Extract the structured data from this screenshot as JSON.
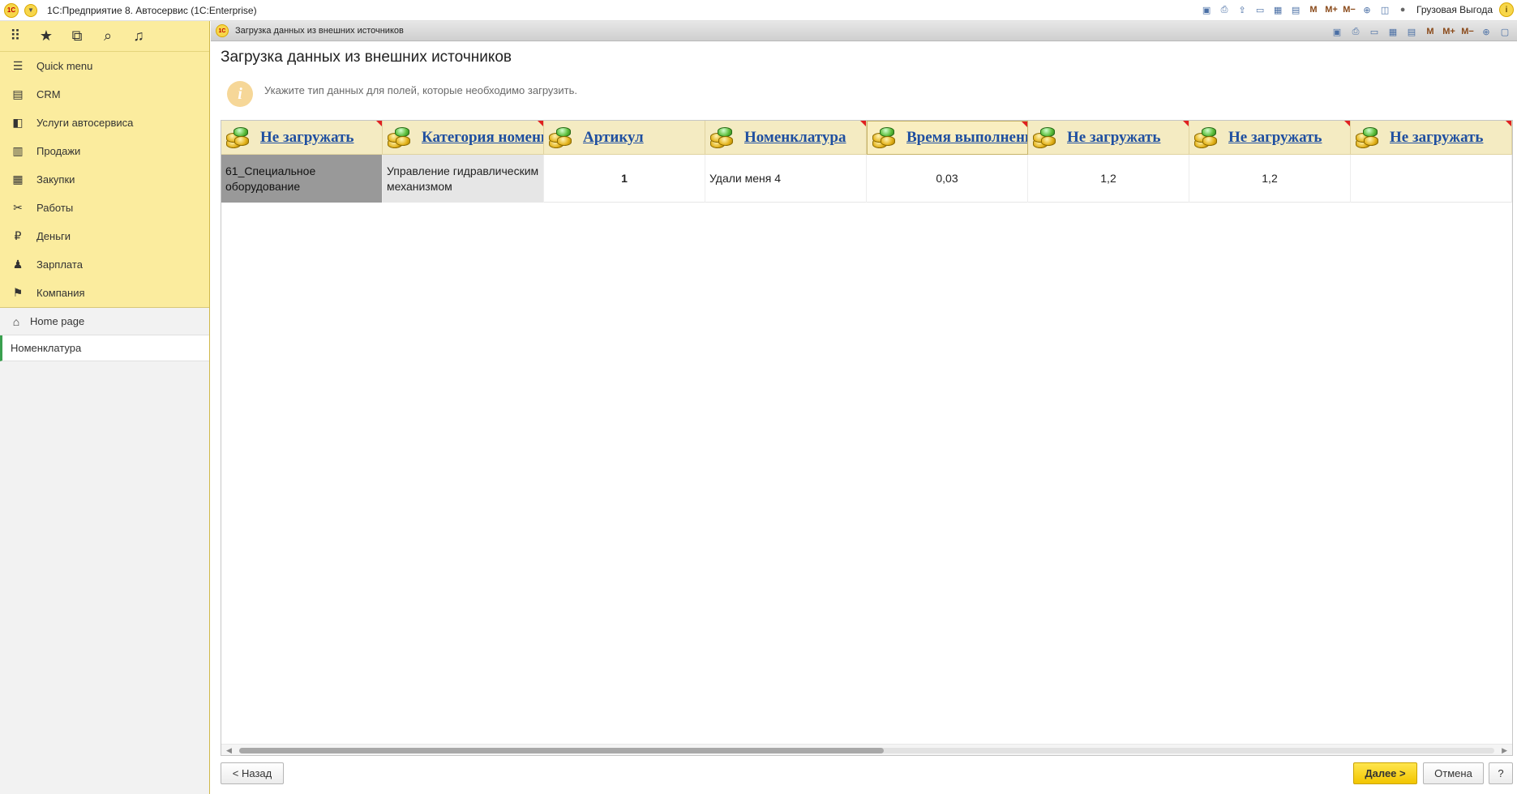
{
  "titlebar": {
    "logo": "1С",
    "app_title": "1С:Предприятие 8. Автосервис  (1С:Enterprise)",
    "user": "Грузовая Выгода",
    "icons": [
      "save-icon",
      "print-icon",
      "upload-icon",
      "print-preview-icon",
      "calculator-icon",
      "calendar-icon",
      "M",
      "M+",
      "M-",
      "zoom-icon",
      "panels-icon",
      "user-icon",
      "info-icon"
    ],
    "m_labels": [
      "M",
      "M+",
      "M−"
    ]
  },
  "sidebar": {
    "items": [
      {
        "label": "Quick menu",
        "icon": "menu-icon"
      },
      {
        "label": "CRM",
        "icon": "crm-icon"
      },
      {
        "label": "Услуги автосервиса",
        "icon": "car-icon"
      },
      {
        "label": "Продажи",
        "icon": "shop-icon"
      },
      {
        "label": "Закупки",
        "icon": "purchases-icon"
      },
      {
        "label": "Работы",
        "icon": "tools-icon"
      },
      {
        "label": "Деньги",
        "icon": "ruble-icon"
      },
      {
        "label": "Зарплата",
        "icon": "people-icon"
      },
      {
        "label": "Компания",
        "icon": "flag-icon"
      }
    ],
    "home": "Home page",
    "open_tab": "Номенклатура"
  },
  "window": {
    "title": "Загрузка данных из внешних источников",
    "form_title": "Загрузка данных из внешних источников",
    "hint": "Укажите тип данных для полей, которые необходимо загрузить."
  },
  "grid": {
    "columns": [
      "Не загружать",
      "Категория номенклатуры",
      "Артикул",
      "Номенклатура",
      "Время выполнения",
      "Не загружать",
      "Не загружать",
      "Не загружать"
    ],
    "row": [
      "61_Специальное оборудование",
      "Управление гидравлическим механизмом",
      "1",
      "Удали меня 4",
      "0,03",
      "1,2",
      "1,2",
      ""
    ]
  },
  "buttons": {
    "back": "< Назад",
    "next": "Далее >",
    "cancel": "Отмена",
    "help": "?"
  },
  "colors": {
    "sidebar_bg": "#fbec9e",
    "header_bg": "#f4ebc2",
    "link": "#1f4fa0",
    "primary_button": "#f2c500"
  }
}
